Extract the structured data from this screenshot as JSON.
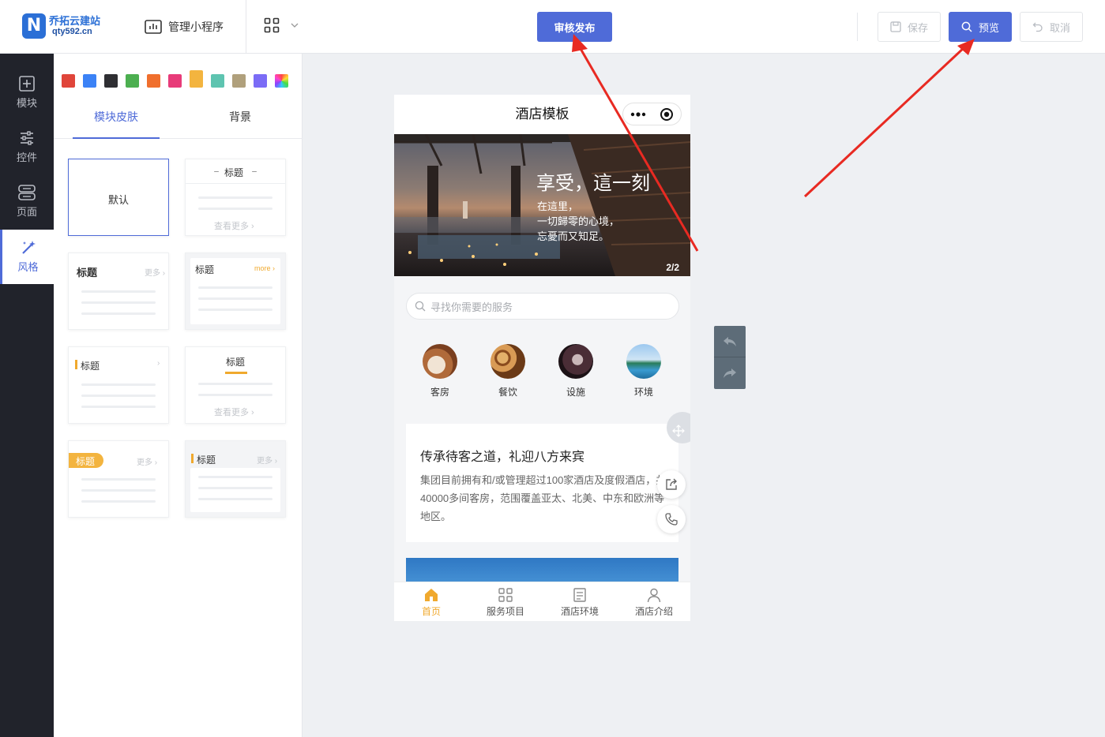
{
  "brand": {
    "title": "乔拓云建站",
    "subtitle": "qty592.cn",
    "logo_letter": "N"
  },
  "topbar": {
    "manage_label": "管理小程序",
    "publish_label": "审核发布",
    "save_label": "保存",
    "preview_label": "预览",
    "cancel_label": "取消"
  },
  "leftnav": [
    {
      "label": "模块",
      "icon": "plus-square-icon"
    },
    {
      "label": "控件",
      "icon": "sliders-icon"
    },
    {
      "label": "页面",
      "icon": "pages-icon"
    },
    {
      "label": "风格",
      "icon": "magic-wand-icon",
      "active": true
    }
  ],
  "panel": {
    "swatches": [
      "#e0453a",
      "#3b82f6",
      "#2f2f33",
      "#4caf50",
      "#f06f2d",
      "#e83b79",
      "#f3b43f",
      "#5ec4b0",
      "#b0a07c",
      "#7b6cf6",
      "rainbow"
    ],
    "selected_swatch": "#f3b43f",
    "tabs": [
      "模块皮肤",
      "背景"
    ],
    "active_tab": "模块皮肤",
    "skins": {
      "default_label": "默认",
      "title": "标题",
      "more": "更多",
      "see_more": "查看更多",
      "more_en": "more"
    }
  },
  "phone": {
    "title": "酒店模板",
    "banner": {
      "heading": "享受，這一刻",
      "lines": [
        "在這里，",
        "一切歸零的心境，",
        "忘憂而又知足。"
      ],
      "index": "2/2"
    },
    "search_placeholder": "寻找你需要的服务",
    "categories": [
      "客房",
      "餐饮",
      "设施",
      "环境"
    ],
    "intro": {
      "heading": "传承待客之道，礼迎八方来宾",
      "body": "集团目前拥有和/或管理超过100家酒店及度假酒店，共40000多间客房，范围覆盖亚太、北美、中东和欧洲等地区。"
    },
    "tabbar": [
      "首页",
      "服务项目",
      "酒店环境",
      "酒店介绍"
    ],
    "active_tab": "首页"
  },
  "colors": {
    "primary": "#4f6bd8",
    "accent": "#f0a92e",
    "nav_bg": "#21232b",
    "annotation": "#e82a22"
  }
}
